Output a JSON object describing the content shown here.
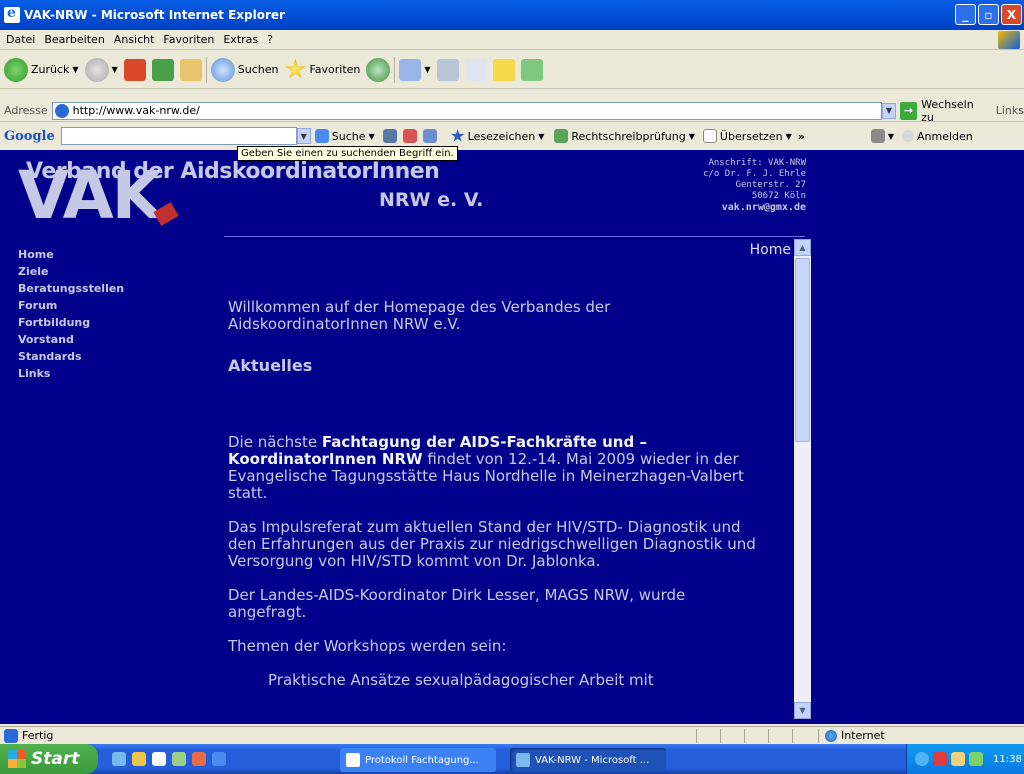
{
  "window": {
    "title": "VAK-NRW - Microsoft Internet Explorer",
    "min": "_",
    "max": "▫",
    "close": "X"
  },
  "menu": [
    "Datei",
    "Bearbeiten",
    "Ansicht",
    "Favoriten",
    "Extras",
    "?"
  ],
  "toolbar": {
    "back": "Zurück",
    "search": "Suchen",
    "favorites": "Favoriten"
  },
  "address": {
    "label": "Adresse",
    "url": "http://www.vak-nrw.de/",
    "go": "Wechseln zu",
    "links": "Links"
  },
  "googlebar": {
    "logo": "Google",
    "search": "Suche",
    "bookmarks": "Lesezeichen",
    "spell": "Rechtschreibprüfung",
    "translate": "Übersetzen",
    "more": "»",
    "signin": "Anmelden",
    "tooltip": "Geben Sie einen zu suchenden Begriff ein."
  },
  "site": {
    "logo": "VAK",
    "org_line1": "Verband der AidskoordinatorInnen",
    "org_line2": "NRW e. V.",
    "address": [
      "Anschrift: VAK-NRW",
      "c/o Dr. F. J. Ehrle",
      "Genterstr. 27",
      "50672 Köln"
    ],
    "email": "vak.nrw@gmx.de",
    "nav": [
      "Home",
      "Ziele",
      "Beratungsstellen",
      "Forum",
      "Fortbildung",
      "Vorstand",
      "Standards",
      "Links"
    ],
    "frame_label": "Home",
    "welcome": "Willkommen auf der Homepage des Verbandes der AidskoordinatorInnen NRW e.V.",
    "heading": "Aktuelles",
    "p1_pre": "Die nächste ",
    "p1_bold": "Fachtagung der AIDS-Fachkräfte und –KoordinatorInnen NRW",
    "p1_post": " findet von 12.-14. Mai 2009 wieder in der Evangelische Tagungsstätte Haus Nordhelle in Meinerzhagen-Valbert statt.",
    "p2": "Das Impulsreferat zum aktuellen Stand der HIV/STD- Diagnostik und den Erfahrungen aus der Praxis zur niedrigschwelligen Diagnostik und Versorgung von HIV/STD kommt von Dr. Jablonka.",
    "p3": "Der Landes-AIDS-Koordinator Dirk Lesser, MAGS NRW, wurde angefragt.",
    "p4": "Themen der Workshops werden sein:",
    "p5": "Praktische Ansätze sexualpädagogischer Arbeit mit"
  },
  "status": {
    "text": "Fertig",
    "zone": "Internet"
  },
  "taskbar": {
    "start": "Start",
    "task1": "Protokoll Fachtagung...",
    "task2": "VAK-NRW - Microsoft ...",
    "clock": "11:38"
  }
}
